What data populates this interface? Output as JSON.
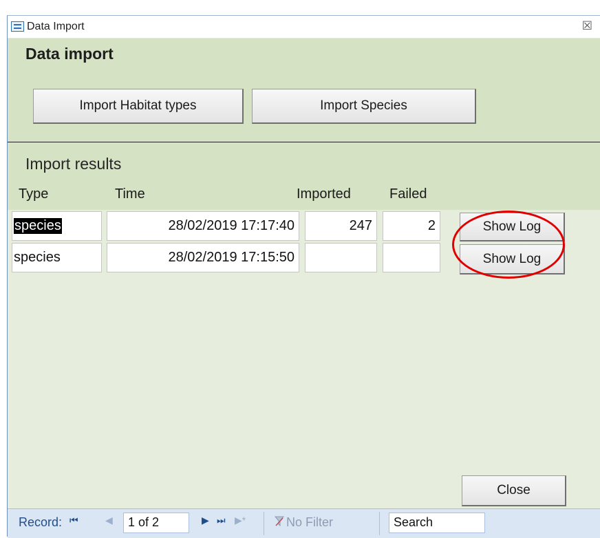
{
  "window": {
    "title": "Data Import",
    "close_glyph": "☒"
  },
  "header": {
    "heading": "Data import",
    "buttons": {
      "import_habitat": "Import Habitat types",
      "import_species": "Import Species"
    }
  },
  "results": {
    "section_title": "Import results",
    "columns": [
      "Type",
      "Time",
      "Imported",
      "Failed"
    ],
    "rows": [
      {
        "type": "species",
        "time": "28/02/2019 17:17:40",
        "imported": "247",
        "failed": "2",
        "action": "Show Log"
      },
      {
        "type": "species",
        "time": "28/02/2019 17:15:50",
        "imported": "",
        "failed": "",
        "action": "Show Log"
      }
    ]
  },
  "footer": {
    "close_label": "Close"
  },
  "navbar": {
    "record_label": "Record:",
    "first_glyph": "⏮",
    "prev_glyph": "◀",
    "record_value": "1 of 2",
    "next_glyph": "▶",
    "last_glyph": "⏭",
    "new_glyph": "▶*",
    "no_filter": "No Filter",
    "search_placeholder": "Search"
  },
  "colors": {
    "form_bg": "#e7eddc",
    "header_bg": "#d6e2c4",
    "annotation": "#e00000",
    "nav_bg": "#dbe6f4"
  }
}
